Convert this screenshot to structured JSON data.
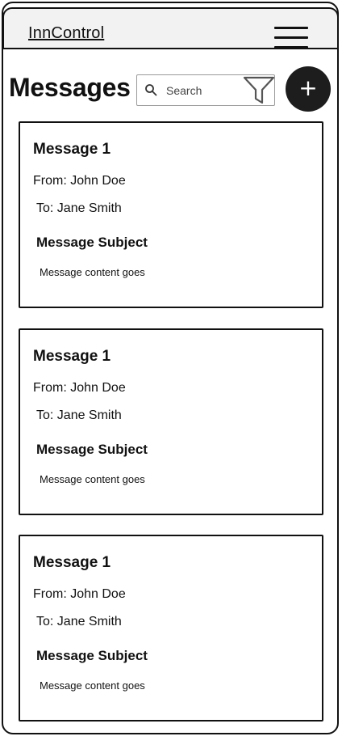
{
  "header": {
    "brand": "InnControl",
    "menu_icon": "hamburger-menu-icon"
  },
  "page": {
    "title": "Messages"
  },
  "search": {
    "placeholder": "Search",
    "value": "",
    "icon": "search-icon",
    "filter_icon": "filter-icon"
  },
  "add_button": {
    "label": "+",
    "icon": "plus-icon"
  },
  "messages": [
    {
      "title": "Message 1",
      "from": "From: John Doe",
      "to": "To:  Jane Smith",
      "subject": "Message Subject",
      "body": "Message content goes"
    },
    {
      "title": "Message 1",
      "from": "From: John Doe",
      "to": "To:  Jane Smith",
      "subject": "Message Subject",
      "body": "Message content goes"
    },
    {
      "title": "Message 1",
      "from": "From: John Doe",
      "to": "To:  Jane Smith",
      "subject": "Message Subject",
      "body": "Message content goes"
    }
  ]
}
